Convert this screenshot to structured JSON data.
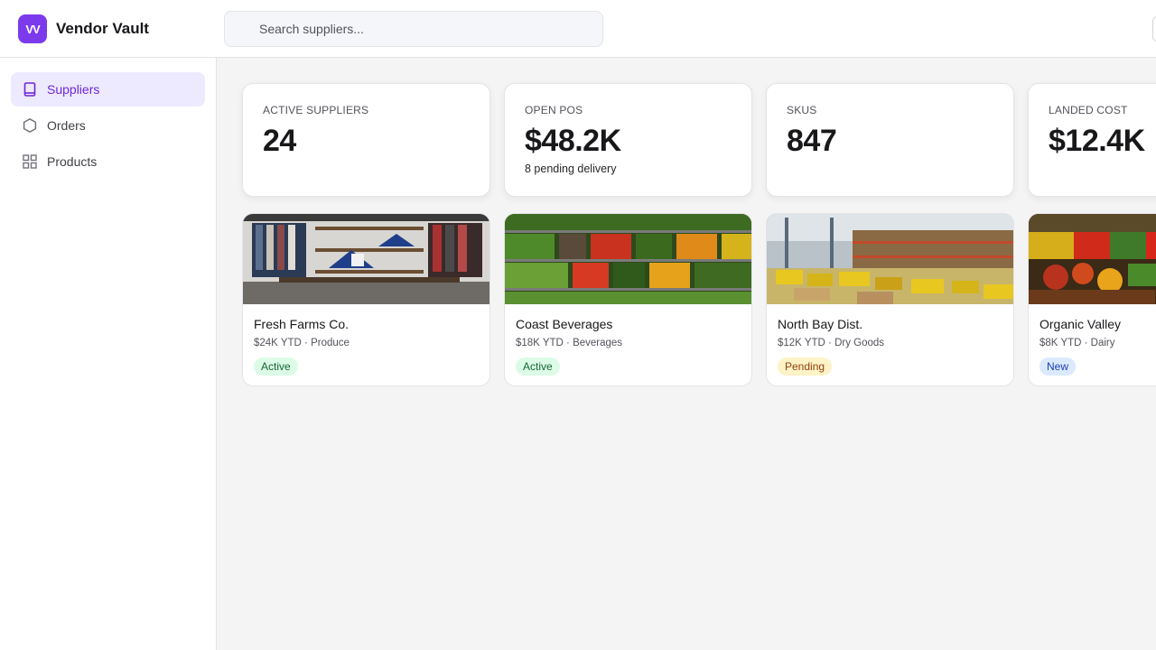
{
  "app": {
    "logo_text": "VV",
    "name": "Vendor Vault"
  },
  "search": {
    "placeholder": "Search suppliers..."
  },
  "sidebar": {
    "items": [
      {
        "label": "Suppliers",
        "icon": "book-icon",
        "active": true
      },
      {
        "label": "Orders",
        "icon": "hexagon-icon",
        "active": false
      },
      {
        "label": "Products",
        "icon": "grid-icon",
        "active": false
      }
    ]
  },
  "stats": [
    {
      "label": "Active Suppliers",
      "value": "24",
      "sub": ""
    },
    {
      "label": "Open POs",
      "value": "$48.2K",
      "sub": "8 pending delivery"
    },
    {
      "label": "SKUs",
      "value": "847",
      "sub": ""
    },
    {
      "label": "Landed Cost",
      "value": "$12.4K",
      "sub": ""
    }
  ],
  "suppliers": [
    {
      "name": "Fresh Farms Co.",
      "meta": "$24K YTD · Produce",
      "status": "Active",
      "status_kind": "active",
      "image": "store-shelves-image"
    },
    {
      "name": "Coast Beverages",
      "meta": "$18K YTD · Beverages",
      "status": "Active",
      "status_kind": "active",
      "image": "produce-shelves-image"
    },
    {
      "name": "North Bay Dist.",
      "meta": "$12K YTD · Dry Goods",
      "status": "Pending",
      "status_kind": "pending",
      "image": "warehouse-image"
    },
    {
      "name": "Organic Valley",
      "meta": "$8K YTD · Dairy",
      "status": "New",
      "status_kind": "new",
      "image": "market-produce-image"
    }
  ],
  "colors": {
    "accent": "#7c3aed",
    "active_nav_bg": "#ede9fe",
    "active_badge_bg": "#dcfce7",
    "pending_badge_bg": "#fef3c7",
    "new_badge_bg": "#dbeafe"
  }
}
